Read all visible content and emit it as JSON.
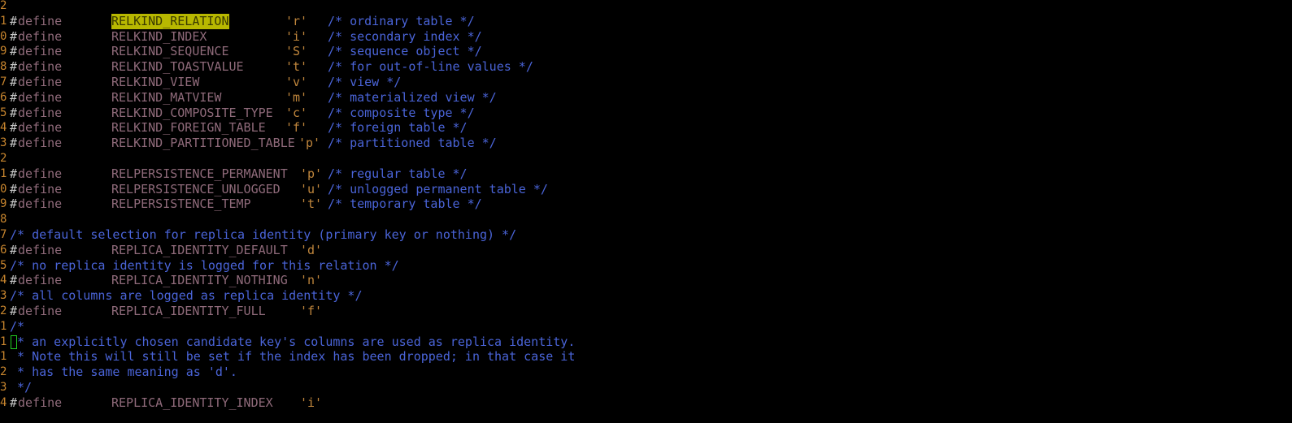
{
  "editor": {
    "lines": [
      {
        "num": "2"
      },
      {
        "num": "1",
        "hash": "#",
        "kw": "define",
        "macro": "RELKIND_RELATION",
        "highlight": true,
        "val": "'r'",
        "comment": "/* ordinary table */"
      },
      {
        "num": "0",
        "hash": "#",
        "kw": "define",
        "macro": "RELKIND_INDEX",
        "val": "'i'",
        "comment": "/* secondary index */"
      },
      {
        "num": "9",
        "hash": "#",
        "kw": "define",
        "macro": "RELKIND_SEQUENCE",
        "val": "'S'",
        "comment": "/* sequence object */"
      },
      {
        "num": "8",
        "hash": "#",
        "kw": "define",
        "macro": "RELKIND_TOASTVALUE",
        "val": "'t'",
        "comment": "/* for out-of-line values */"
      },
      {
        "num": "7",
        "hash": "#",
        "kw": "define",
        "macro": "RELKIND_VIEW",
        "val": "'v'",
        "comment": "/* view */"
      },
      {
        "num": "6",
        "hash": "#",
        "kw": "define",
        "macro": "RELKIND_MATVIEW",
        "val": "'m'",
        "comment": "/* materialized view */"
      },
      {
        "num": "5",
        "hash": "#",
        "kw": "define",
        "macro": "RELKIND_COMPOSITE_TYPE",
        "val": "'c'",
        "comment": "/* composite type */"
      },
      {
        "num": "4",
        "hash": "#",
        "kw": "define",
        "macro": "RELKIND_FOREIGN_TABLE",
        "val": "'f'",
        "comment": "/* foreign table */"
      },
      {
        "num": "3",
        "hash": "#",
        "kw": "define",
        "macro": "RELKIND_PARTITIONED_TABLE",
        "val": "'p'",
        "comment": "/* partitioned table */"
      },
      {
        "num": "2"
      },
      {
        "num": "1",
        "hash": "#",
        "kw": "define",
        "macro": "RELPERSISTENCE_PERMANENT",
        "val": "'p'",
        "comment": "/* regular table */"
      },
      {
        "num": "0",
        "hash": "#",
        "kw": "define",
        "macro": "RELPERSISTENCE_UNLOGGED",
        "val": "'u'",
        "comment": "/* unlogged permanent table */"
      },
      {
        "num": "9",
        "hash": "#",
        "kw": "define",
        "macro": "RELPERSISTENCE_TEMP",
        "val": "'t'",
        "comment": "/* temporary table */"
      },
      {
        "num": "8"
      },
      {
        "num": "7",
        "fullcomment": "/* default selection for replica identity (primary key or nothing) */"
      },
      {
        "num": "6",
        "hash": "#",
        "kw": "define",
        "macro": "REPLICA_IDENTITY_DEFAULT",
        "val": "'d'"
      },
      {
        "num": "5",
        "fullcomment": "/* no replica identity is logged for this relation */"
      },
      {
        "num": "4",
        "hash": "#",
        "kw": "define",
        "macro": "REPLICA_IDENTITY_NOTHING",
        "val": "'n'"
      },
      {
        "num": "3",
        "fullcomment": "/* all columns are logged as replica identity */"
      },
      {
        "num": "2",
        "hash": "#",
        "kw": "define",
        "macro": "REPLICA_IDENTITY_FULL",
        "val": "'f'"
      },
      {
        "num": "1",
        "fullcomment": "/*"
      },
      {
        "num": "1",
        "cursor": true,
        "fullcomment": " * an explicitly chosen candidate key's columns are used as replica identity."
      },
      {
        "num": "1",
        "fullcomment": " * Note this will still be set if the index has been dropped; in that case it"
      },
      {
        "num": "2",
        "fullcomment": " * has the same meaning as 'd'."
      },
      {
        "num": "3",
        "fullcomment": " */"
      },
      {
        "num": "4",
        "hash": "#",
        "kw": "define",
        "macro": "REPLICA_IDENTITY_INDEX",
        "val": "'i'"
      }
    ]
  }
}
